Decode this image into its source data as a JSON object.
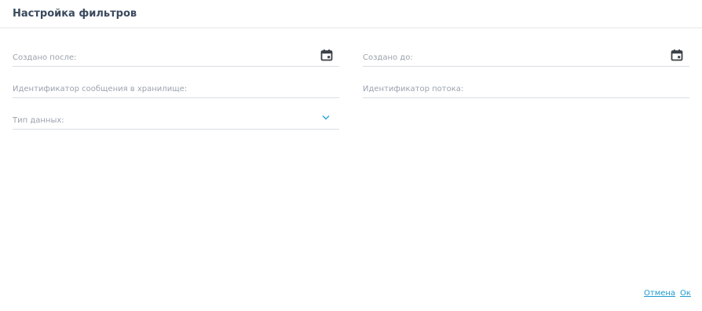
{
  "dialog": {
    "title": "Настройка фильтров"
  },
  "filters": {
    "created_after": {
      "label": "Создано после:",
      "icon": "calendar-icon"
    },
    "created_before": {
      "label": "Создано до:",
      "icon": "calendar-icon"
    },
    "storage_message_id": {
      "label": "Идентификатор сообщения в хранилище:"
    },
    "stream_id": {
      "label": "Идентификатор потока:"
    },
    "data_type": {
      "label": "Тип данных:",
      "icon": "chevron-down-icon"
    }
  },
  "actions": {
    "cancel_label": "Отмена",
    "ok_label": "Ок"
  },
  "colors": {
    "title": "#3a4a5e",
    "label": "#9aa3ad",
    "link": "#1e9bd0",
    "chevron": "#2aa3d4",
    "divider": "#d9dde2"
  }
}
